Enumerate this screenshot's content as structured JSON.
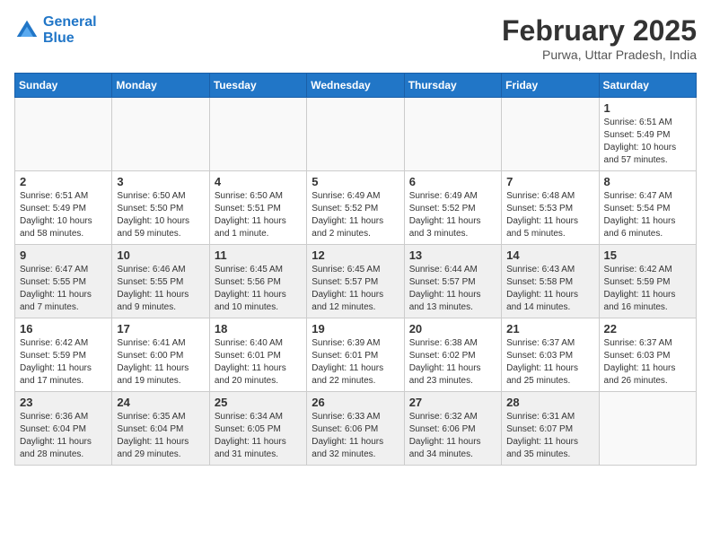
{
  "header": {
    "logo_line1": "General",
    "logo_line2": "Blue",
    "month_year": "February 2025",
    "location": "Purwa, Uttar Pradesh, India"
  },
  "weekdays": [
    "Sunday",
    "Monday",
    "Tuesday",
    "Wednesday",
    "Thursday",
    "Friday",
    "Saturday"
  ],
  "weeks": [
    {
      "shaded": false,
      "days": [
        {
          "num": "",
          "info": ""
        },
        {
          "num": "",
          "info": ""
        },
        {
          "num": "",
          "info": ""
        },
        {
          "num": "",
          "info": ""
        },
        {
          "num": "",
          "info": ""
        },
        {
          "num": "",
          "info": ""
        },
        {
          "num": "1",
          "info": "Sunrise: 6:51 AM\nSunset: 5:49 PM\nDaylight: 10 hours\nand 57 minutes."
        }
      ]
    },
    {
      "shaded": false,
      "days": [
        {
          "num": "2",
          "info": "Sunrise: 6:51 AM\nSunset: 5:49 PM\nDaylight: 10 hours\nand 58 minutes."
        },
        {
          "num": "3",
          "info": "Sunrise: 6:50 AM\nSunset: 5:50 PM\nDaylight: 10 hours\nand 59 minutes."
        },
        {
          "num": "4",
          "info": "Sunrise: 6:50 AM\nSunset: 5:51 PM\nDaylight: 11 hours\nand 1 minute."
        },
        {
          "num": "5",
          "info": "Sunrise: 6:49 AM\nSunset: 5:52 PM\nDaylight: 11 hours\nand 2 minutes."
        },
        {
          "num": "6",
          "info": "Sunrise: 6:49 AM\nSunset: 5:52 PM\nDaylight: 11 hours\nand 3 minutes."
        },
        {
          "num": "7",
          "info": "Sunrise: 6:48 AM\nSunset: 5:53 PM\nDaylight: 11 hours\nand 5 minutes."
        },
        {
          "num": "8",
          "info": "Sunrise: 6:47 AM\nSunset: 5:54 PM\nDaylight: 11 hours\nand 6 minutes."
        }
      ]
    },
    {
      "shaded": true,
      "days": [
        {
          "num": "9",
          "info": "Sunrise: 6:47 AM\nSunset: 5:55 PM\nDaylight: 11 hours\nand 7 minutes."
        },
        {
          "num": "10",
          "info": "Sunrise: 6:46 AM\nSunset: 5:55 PM\nDaylight: 11 hours\nand 9 minutes."
        },
        {
          "num": "11",
          "info": "Sunrise: 6:45 AM\nSunset: 5:56 PM\nDaylight: 11 hours\nand 10 minutes."
        },
        {
          "num": "12",
          "info": "Sunrise: 6:45 AM\nSunset: 5:57 PM\nDaylight: 11 hours\nand 12 minutes."
        },
        {
          "num": "13",
          "info": "Sunrise: 6:44 AM\nSunset: 5:57 PM\nDaylight: 11 hours\nand 13 minutes."
        },
        {
          "num": "14",
          "info": "Sunrise: 6:43 AM\nSunset: 5:58 PM\nDaylight: 11 hours\nand 14 minutes."
        },
        {
          "num": "15",
          "info": "Sunrise: 6:42 AM\nSunset: 5:59 PM\nDaylight: 11 hours\nand 16 minutes."
        }
      ]
    },
    {
      "shaded": false,
      "days": [
        {
          "num": "16",
          "info": "Sunrise: 6:42 AM\nSunset: 5:59 PM\nDaylight: 11 hours\nand 17 minutes."
        },
        {
          "num": "17",
          "info": "Sunrise: 6:41 AM\nSunset: 6:00 PM\nDaylight: 11 hours\nand 19 minutes."
        },
        {
          "num": "18",
          "info": "Sunrise: 6:40 AM\nSunset: 6:01 PM\nDaylight: 11 hours\nand 20 minutes."
        },
        {
          "num": "19",
          "info": "Sunrise: 6:39 AM\nSunset: 6:01 PM\nDaylight: 11 hours\nand 22 minutes."
        },
        {
          "num": "20",
          "info": "Sunrise: 6:38 AM\nSunset: 6:02 PM\nDaylight: 11 hours\nand 23 minutes."
        },
        {
          "num": "21",
          "info": "Sunrise: 6:37 AM\nSunset: 6:03 PM\nDaylight: 11 hours\nand 25 minutes."
        },
        {
          "num": "22",
          "info": "Sunrise: 6:37 AM\nSunset: 6:03 PM\nDaylight: 11 hours\nand 26 minutes."
        }
      ]
    },
    {
      "shaded": true,
      "days": [
        {
          "num": "23",
          "info": "Sunrise: 6:36 AM\nSunset: 6:04 PM\nDaylight: 11 hours\nand 28 minutes."
        },
        {
          "num": "24",
          "info": "Sunrise: 6:35 AM\nSunset: 6:04 PM\nDaylight: 11 hours\nand 29 minutes."
        },
        {
          "num": "25",
          "info": "Sunrise: 6:34 AM\nSunset: 6:05 PM\nDaylight: 11 hours\nand 31 minutes."
        },
        {
          "num": "26",
          "info": "Sunrise: 6:33 AM\nSunset: 6:06 PM\nDaylight: 11 hours\nand 32 minutes."
        },
        {
          "num": "27",
          "info": "Sunrise: 6:32 AM\nSunset: 6:06 PM\nDaylight: 11 hours\nand 34 minutes."
        },
        {
          "num": "28",
          "info": "Sunrise: 6:31 AM\nSunset: 6:07 PM\nDaylight: 11 hours\nand 35 minutes."
        },
        {
          "num": "",
          "info": ""
        }
      ]
    }
  ]
}
